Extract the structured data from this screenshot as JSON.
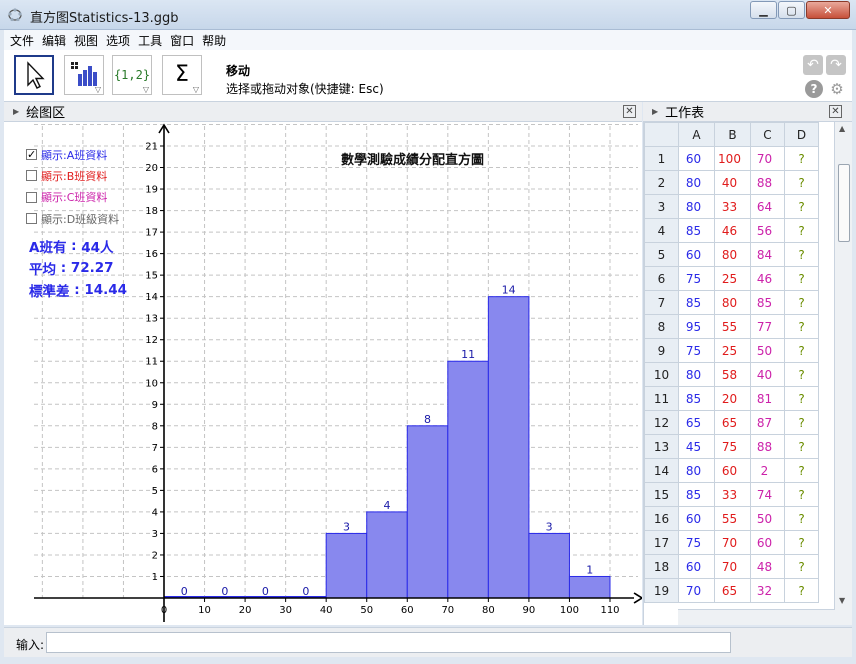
{
  "window": {
    "title": "直方图Statistics-13.ggb",
    "minimize_icon": "minimize-icon",
    "maximize_icon": "maximize-icon",
    "close_icon": "close-icon"
  },
  "menu": [
    "文件",
    "编辑",
    "视图",
    "选项",
    "工具",
    "窗口",
    "帮助"
  ],
  "toolbar": {
    "tools": [
      {
        "name": "move-tool",
        "icon": "arrow-cursor-icon",
        "active": true
      },
      {
        "name": "histogram-tool",
        "icon": "histogram-icon",
        "active": false
      },
      {
        "name": "list-tool",
        "icon": "list-braces-icon",
        "label": "{1,2}",
        "active": false
      },
      {
        "name": "sum-tool",
        "icon": "sigma-icon",
        "label": "Σ",
        "active": false
      }
    ],
    "current_tool": "移动",
    "current_tool_help": "选择或拖动对象(快捷键: Esc)",
    "undo_icon": "undo-icon",
    "redo_icon": "redo-icon",
    "help_icon": "help-icon",
    "settings_icon": "gear-icon"
  },
  "graphics": {
    "header": "绘图区",
    "checkboxes": [
      {
        "label": "顯示:A班資料",
        "checked": true,
        "color": "#2a2ae8"
      },
      {
        "label": "顯示:B班資料",
        "checked": false,
        "color": "#e01b1b"
      },
      {
        "label": "顯示:C班資料",
        "checked": false,
        "color": "#cc22aa"
      },
      {
        "label": "顯示:D班級資料",
        "checked": false,
        "color": "#666666"
      }
    ],
    "stats": [
      {
        "name": "A班有",
        "value": "44人"
      },
      {
        "name": "平均",
        "value": "72.27"
      },
      {
        "name": "標準差",
        "value": "14.44"
      }
    ]
  },
  "spreadsheet": {
    "header": "工作表",
    "columns": [
      "A",
      "B",
      "C",
      "D"
    ],
    "rows": [
      [
        "60",
        "100",
        "70",
        "?"
      ],
      [
        "80",
        "40",
        "88",
        "?"
      ],
      [
        "80",
        "33",
        "64",
        "?"
      ],
      [
        "85",
        "46",
        "56",
        "?"
      ],
      [
        "60",
        "80",
        "84",
        "?"
      ],
      [
        "75",
        "25",
        "46",
        "?"
      ],
      [
        "85",
        "80",
        "85",
        "?"
      ],
      [
        "95",
        "55",
        "77",
        "?"
      ],
      [
        "75",
        "25",
        "50",
        "?"
      ],
      [
        "80",
        "58",
        "40",
        "?"
      ],
      [
        "85",
        "20",
        "81",
        "?"
      ],
      [
        "65",
        "65",
        "87",
        "?"
      ],
      [
        "45",
        "75",
        "88",
        "?"
      ],
      [
        "80",
        "60",
        "2",
        "?"
      ],
      [
        "85",
        "33",
        "74",
        "?"
      ],
      [
        "60",
        "55",
        "50",
        "?"
      ],
      [
        "75",
        "70",
        "60",
        "?"
      ],
      [
        "60",
        "70",
        "48",
        "?"
      ],
      [
        "70",
        "65",
        "32",
        "?"
      ]
    ]
  },
  "input_bar": {
    "label": "输入:",
    "value": ""
  },
  "chart_data": {
    "type": "bar",
    "title": "數學測驗成績分配直方圖",
    "xlabel": "",
    "ylabel": "",
    "bin_edges": [
      0,
      10,
      20,
      30,
      40,
      50,
      60,
      70,
      80,
      90,
      100,
      110
    ],
    "values": [
      0,
      0,
      0,
      0,
      3,
      4,
      8,
      11,
      14,
      3,
      1
    ],
    "xlim": [
      0,
      110
    ],
    "ylim": [
      0,
      21
    ],
    "x_ticks": [
      0,
      10,
      20,
      30,
      40,
      50,
      60,
      70,
      80,
      90,
      100,
      110
    ],
    "y_ticks": [
      1,
      2,
      3,
      4,
      5,
      6,
      7,
      8,
      9,
      10,
      11,
      12,
      13,
      14,
      15,
      16,
      17,
      18,
      19,
      20,
      21
    ],
    "grid": true,
    "bar_color": "#8888ee",
    "edge_color": "#2a2ae8",
    "label_color": "#1a1aa8"
  }
}
